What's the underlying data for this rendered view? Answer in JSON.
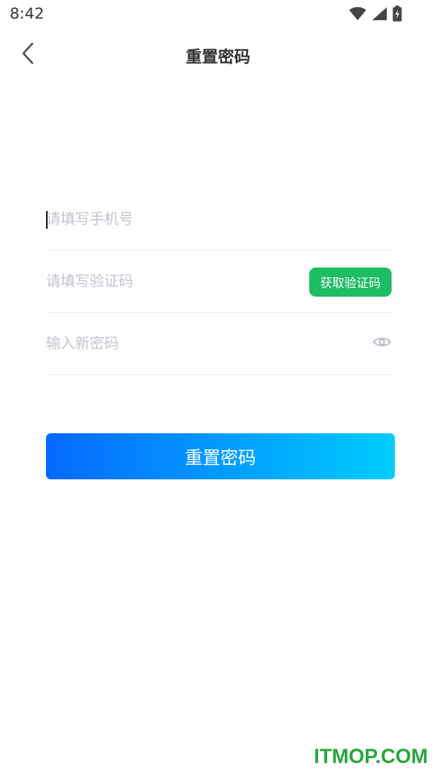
{
  "status_bar": {
    "time": "8:42",
    "icons": [
      "wifi-icon",
      "cellular-signal-icon",
      "battery-charging-icon"
    ]
  },
  "header": {
    "back_icon": "chevron-left-icon",
    "title": "重置密码"
  },
  "form": {
    "phone": {
      "value": "",
      "placeholder": "请填写手机号"
    },
    "code": {
      "value": "",
      "placeholder": "请填写验证码",
      "get_code_label": "获取验证码"
    },
    "password": {
      "value": "",
      "placeholder": "输入新密码",
      "toggle_icon": "eye-icon"
    }
  },
  "submit": {
    "label": "重置密码"
  },
  "watermark": {
    "text": "ITMOP.COM"
  },
  "colors": {
    "get_code_bg": "#1dbd63",
    "submit_gradient_start": "#0668ff",
    "submit_gradient_end": "#00cdfd",
    "placeholder": "#c0c4cc",
    "watermark": "#26a63b"
  }
}
